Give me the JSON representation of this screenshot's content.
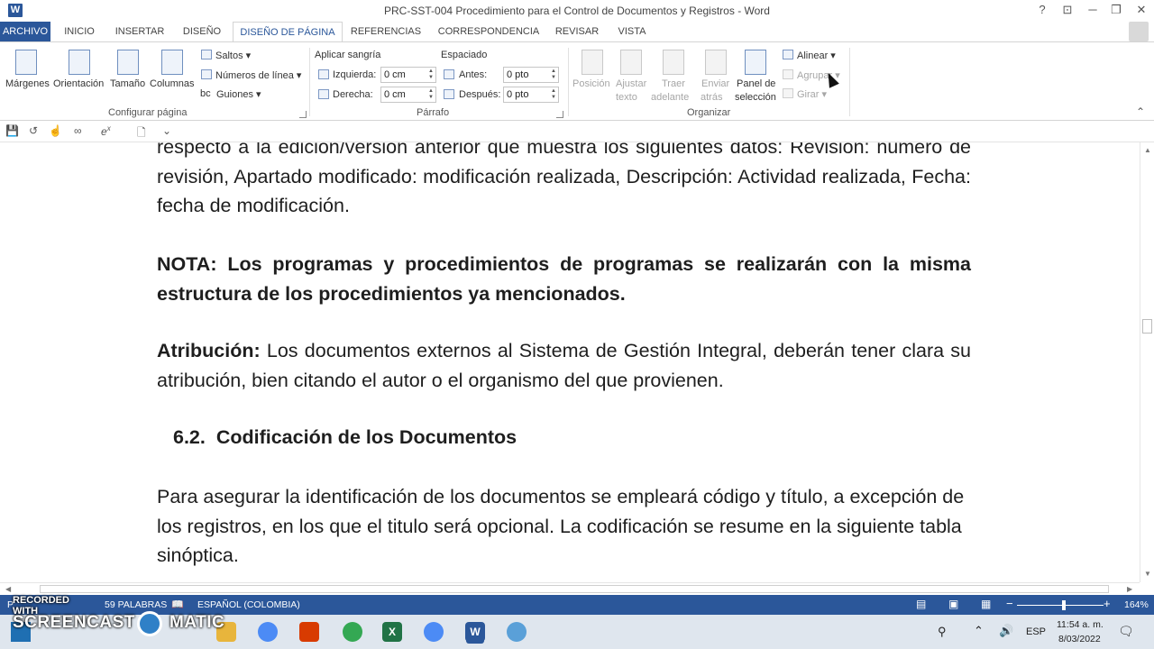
{
  "window": {
    "app_icon": "W",
    "title": "PRC-SST-004 Procedimiento para el Control de Documentos y Registros - Word",
    "help": "?",
    "ribbon_display": "⊡",
    "minimize": "─",
    "restore": "❐",
    "close": "✕"
  },
  "tabs": [
    "ARCHIVO",
    "INICIO",
    "INSERTAR",
    "DISEÑO",
    "DISEÑO DE PÁGINA",
    "REFERENCIAS",
    "CORRESPONDENCIA",
    "REVISAR",
    "VISTA"
  ],
  "ribbon": {
    "configurar": {
      "margenes": "Márgenes",
      "orientacion": "Orientación",
      "tamano": "Tamaño",
      "columnas": "Columnas",
      "saltos": "Saltos",
      "numeros_linea": "Números de línea",
      "guiones": "Guiones",
      "guiones_prefix": "bc",
      "label": "Configurar página"
    },
    "parrafo": {
      "sangria_title": "Aplicar sangría",
      "izquierda": "Izquierda:",
      "izquierda_value": "0 cm",
      "derecha": "Derecha:",
      "derecha_value": "0 cm",
      "espaciado_title": "Espaciado",
      "antes": "Antes:",
      "antes_value": "0 pto",
      "despues": "Después:",
      "despues_value": "0 pto",
      "label": "Párrafo"
    },
    "organizar": {
      "posicion": "Posición",
      "ajustar": [
        "Ajustar",
        "texto"
      ],
      "traer": [
        "Traer",
        "adelante"
      ],
      "enviar": [
        "Enviar",
        "atrás"
      ],
      "panel": [
        "Panel de",
        "selección"
      ],
      "alinear": "Alinear",
      "agrupar": "Agrupar",
      "girar": "Girar",
      "label": "Organizar"
    }
  },
  "qat": {
    "save": "💾",
    "undo": "↺",
    "touch": "☝",
    "infinity": "∞",
    "equation": "e",
    "equation_sup": "x",
    "document": "🗋",
    "customize": "⌄"
  },
  "document": {
    "para1": "respecto a la edición/versión  anterior que muestra los siguientes datos: Revisión: número de revisión, Apartado modificado: modificación realizada, Descripción: Actividad realizada, Fecha: fecha de modificación.",
    "nota": "NOTA: Los programas y procedimientos de programas se realizarán con la misma estructura de los procedimientos ya mencionados.",
    "atribucion_label": "Atribución:",
    "atribucion_text": " Los documentos externos al Sistema de Gestión Integral, deberán tener clara su atribución, bien citando el autor o el organismo del que provienen.",
    "heading_num": "6.2.",
    "heading_text": "Codificación de los Documentos",
    "para_last": "Para asegurar la identificación de los documentos se empleará código y título, a excepción de los registros, en los que el titulo será opcional. La codificación se resume en la siguiente tabla sinóptica."
  },
  "status_bar": {
    "page": "P",
    "words": "59 PALABRAS",
    "language": "ESPAÑOL (COLOMBIA)",
    "zoom_minus": "−",
    "zoom_plus": "+",
    "zoom": "164%"
  },
  "watermark": {
    "line1": "RECORDED WITH",
    "line2_a": "SCREENCAST",
    "line2_b": "MATIC"
  },
  "taskbar": {
    "language": "ESP",
    "time": "11:54 a. m.",
    "date": "8/03/2022"
  }
}
